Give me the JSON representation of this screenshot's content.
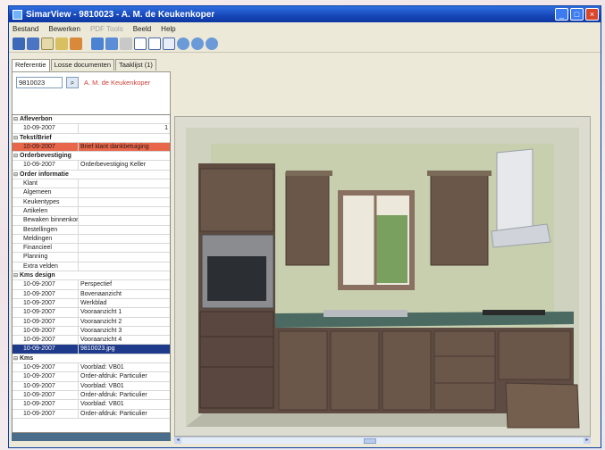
{
  "window": {
    "title": "SimarView - 9810023 - A. M. de Keukenkoper",
    "controls": [
      "_",
      "□",
      "×"
    ]
  },
  "menu": {
    "items": [
      {
        "label": "Bestand",
        "enabled": true
      },
      {
        "label": "Bewerken",
        "enabled": true
      },
      {
        "label": "PDF Tools",
        "enabled": false
      },
      {
        "label": "Beeld",
        "enabled": true
      },
      {
        "label": "Help",
        "enabled": true
      }
    ]
  },
  "toolbar": {
    "icons": [
      "scan-icon",
      "scan-multi-icon",
      "envelope-icon",
      "edit-icon",
      "user-icon",
      "page-save-icon",
      "page-copy-icon",
      "print-icon",
      "doc-icon",
      "doc-icon",
      "grid-icon",
      "rotate-left-icon",
      "rotate-right-icon",
      "rotate-icon"
    ]
  },
  "left": {
    "tabs": [
      "Referentie",
      "Losse documenten",
      "Taaklijst (1)"
    ],
    "ref_value": "9810023",
    "ref_name": "A. M. de Keukenkoper"
  },
  "tree": {
    "rows": [
      {
        "kind": "header",
        "label": "Afleverbon"
      },
      {
        "kind": "item",
        "date": "10-09-2007",
        "desc": "",
        "count": "1"
      },
      {
        "kind": "header",
        "label": "Tekst/Brief"
      },
      {
        "kind": "item",
        "date": "10-09-2007",
        "desc": "Brief klant dankbetuiging",
        "highlight": "red"
      },
      {
        "kind": "header",
        "label": "Orderbevestiging"
      },
      {
        "kind": "item",
        "date": "10-09-2007",
        "desc": "Orderbevestiging Keller"
      },
      {
        "kind": "header",
        "label": "Order informatie"
      },
      {
        "kind": "item",
        "date": "Klant",
        "desc": ""
      },
      {
        "kind": "item",
        "date": "Algemeen",
        "desc": ""
      },
      {
        "kind": "item",
        "date": "Keukentypes",
        "desc": ""
      },
      {
        "kind": "item",
        "date": "Artikelen",
        "desc": ""
      },
      {
        "kind": "item",
        "date": "Bewaken binnenkomst",
        "desc": ""
      },
      {
        "kind": "item",
        "date": "Bestellingen",
        "desc": ""
      },
      {
        "kind": "item",
        "date": "Meldingen",
        "desc": ""
      },
      {
        "kind": "item",
        "date": "Financieel",
        "desc": ""
      },
      {
        "kind": "item",
        "date": "Planning",
        "desc": ""
      },
      {
        "kind": "item",
        "date": "Extra velden",
        "desc": ""
      },
      {
        "kind": "header",
        "label": "Kms design"
      },
      {
        "kind": "item",
        "date": "10-09-2007",
        "desc": "Perspectief"
      },
      {
        "kind": "item",
        "date": "10-09-2007",
        "desc": "Bovenaanzicht"
      },
      {
        "kind": "item",
        "date": "10-09-2007",
        "desc": "Werkblad"
      },
      {
        "kind": "item",
        "date": "10-09-2007",
        "desc": "Vooraanzicht 1"
      },
      {
        "kind": "item",
        "date": "10-09-2007",
        "desc": "Vooraanzicht 2"
      },
      {
        "kind": "item",
        "date": "10-09-2007",
        "desc": "Vooraanzicht 3"
      },
      {
        "kind": "item",
        "date": "10-09-2007",
        "desc": "Vooraanzicht 4"
      },
      {
        "kind": "item",
        "date": "10-09-2007",
        "desc": "9810023.jpg",
        "highlight": "blue"
      },
      {
        "kind": "header",
        "label": "Kms"
      },
      {
        "kind": "item",
        "date": "10-09-2007",
        "desc": "Voorblad: VB01"
      },
      {
        "kind": "item",
        "date": "10-09-2007",
        "desc": "Order-afdruk: Particulier"
      },
      {
        "kind": "item",
        "date": "10-09-2007",
        "desc": "Voorblad: VB01"
      },
      {
        "kind": "item",
        "date": "10-09-2007",
        "desc": "Order-afdruk: Particulier"
      },
      {
        "kind": "item",
        "date": "10-09-2007",
        "desc": "Voorblad: VB01"
      },
      {
        "kind": "item",
        "date": "10-09-2007",
        "desc": "Order-afdruk: Particulier"
      }
    ]
  },
  "viewer": {
    "image": "kitchen-render"
  }
}
